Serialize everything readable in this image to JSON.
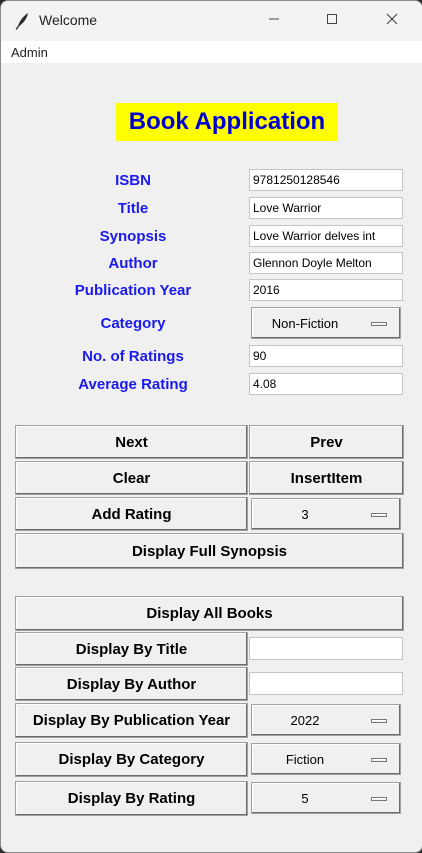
{
  "window": {
    "title": "Welcome"
  },
  "menu": {
    "admin": "Admin"
  },
  "heading": "Book Application",
  "fields": [
    {
      "label": "ISBN",
      "value": "9781250128546"
    },
    {
      "label": "Title",
      "value": "Love Warrior"
    },
    {
      "label": "Synopsis",
      "value": "Love Warrior delves int"
    },
    {
      "label": "Author",
      "value": "Glennon Doyle Melton"
    },
    {
      "label": "Publication Year",
      "value": "2016"
    },
    {
      "label": "Category",
      "value": "Non-Fiction"
    },
    {
      "label": "No. of Ratings",
      "value": "90"
    },
    {
      "label": "Average Rating",
      "value": "4.08"
    }
  ],
  "buttons": {
    "next": "Next",
    "prev": "Prev",
    "clear": "Clear",
    "insert_item": "InsertItem",
    "add_rating": "Add Rating",
    "add_rating_value": "3",
    "display_full_synopsis": "Display Full Synopsis"
  },
  "display": {
    "all_books": "Display All Books",
    "by_title": "Display By Title",
    "by_title_value": "",
    "by_author": "Display By Author",
    "by_author_value": "",
    "by_year": "Display By Publication Year",
    "by_year_value": "2022",
    "by_category": "Display By Category",
    "by_category_value": "Fiction",
    "by_rating": "Display By Rating",
    "by_rating_value": "5"
  },
  "colors": {
    "label_text": "#1a1aee",
    "heading_text": "#0000d0",
    "heading_bg": "#ffff00",
    "window_bg": "#f0f0f0"
  },
  "icons": [
    "feather-icon",
    "minimize-icon",
    "maximize-icon",
    "close-icon",
    "dropdown-indicator-icon"
  ]
}
